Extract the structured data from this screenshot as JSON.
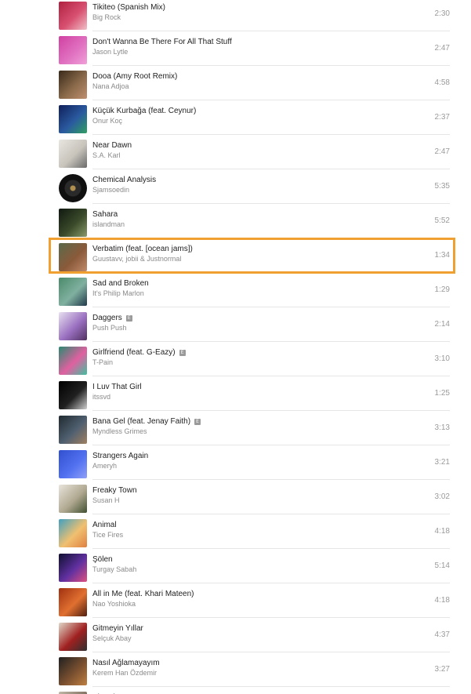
{
  "tracks": [
    {
      "title": "Tikiteo (Spanish Mix)",
      "artist": "Big Rock",
      "duration": "2:30",
      "explicit": false,
      "art": {
        "colors": [
          "#b02040",
          "#d85070",
          "#f0c0c8"
        ],
        "round": false
      }
    },
    {
      "title": "Don't Wanna Be There For All That Stuff",
      "artist": "Jason Lytle",
      "duration": "2:47",
      "explicit": false,
      "art": {
        "colors": [
          "#d040a0",
          "#e070c0",
          "#f0a0d8"
        ],
        "round": false
      }
    },
    {
      "title": "Dooa (Amy Root Remix)",
      "artist": "Nana Adjoa",
      "duration": "4:58",
      "explicit": false,
      "art": {
        "colors": [
          "#3a2a1a",
          "#8a6a4a",
          "#c09070"
        ],
        "round": false
      }
    },
    {
      "title": "Küçük Kurbağa (feat. Ceynur)",
      "artist": "Onur Koç",
      "duration": "2:37",
      "explicit": false,
      "art": {
        "colors": [
          "#10205a",
          "#2a5aa0",
          "#30a060"
        ],
        "round": false
      }
    },
    {
      "title": "Near Dawn",
      "artist": "S.A. Karl",
      "duration": "2:47",
      "explicit": false,
      "art": {
        "colors": [
          "#e8e6e0",
          "#c8c4bc",
          "#6a6a6a"
        ],
        "round": false
      }
    },
    {
      "title": "Chemical Analysis",
      "artist": "Sjamsoedin",
      "duration": "5:35",
      "explicit": false,
      "art": {
        "colors": [
          "#101010",
          "#2a2a2a",
          "#b09050"
        ],
        "round": true
      }
    },
    {
      "title": "Sahara",
      "artist": "islandman",
      "duration": "5:52",
      "explicit": false,
      "art": {
        "colors": [
          "#101810",
          "#3a4a2a",
          "#8a9a6a"
        ],
        "round": false
      }
    },
    {
      "title": "Verbatim (feat. [ocean jams])",
      "artist": "Guustavv, jobii & Justnormal",
      "duration": "1:34",
      "explicit": false,
      "selected": true,
      "art": {
        "colors": [
          "#5a6a4a",
          "#8a5a3a",
          "#c08a6a"
        ],
        "round": false
      }
    },
    {
      "title": "Sad and Broken",
      "artist": "It's Philip Marlon",
      "duration": "1:29",
      "explicit": false,
      "art": {
        "colors": [
          "#4a8a6a",
          "#80b0a0",
          "#203a4a"
        ],
        "round": false
      }
    },
    {
      "title": "Daggers",
      "artist": "Push Push",
      "duration": "2:14",
      "explicit": true,
      "explicit_label": "E",
      "art": {
        "colors": [
          "#e8e0f0",
          "#9a70c0",
          "#503060"
        ],
        "round": false
      }
    },
    {
      "title": "Girlfriend (feat. G-Eazy)",
      "artist": "T-Pain",
      "duration": "3:10",
      "explicit": true,
      "explicit_label": "E",
      "art": {
        "colors": [
          "#2a8a70",
          "#e060a0",
          "#40c0a0"
        ],
        "round": false
      }
    },
    {
      "title": "I Luv That Girl",
      "artist": "itssvd",
      "duration": "1:25",
      "explicit": false,
      "art": {
        "colors": [
          "#000000",
          "#202020",
          "#d0d0d0"
        ],
        "round": false
      }
    },
    {
      "title": "Bana Gel (feat. Jenay Faith)",
      "artist": "Myndless Grimes",
      "duration": "3:13",
      "explicit": true,
      "explicit_label": "E",
      "art": {
        "colors": [
          "#202a30",
          "#506070",
          "#a08060"
        ],
        "round": false
      }
    },
    {
      "title": "Strangers Again",
      "artist": "Ameryh",
      "duration": "3:21",
      "explicit": false,
      "art": {
        "colors": [
          "#3050d0",
          "#5070f0",
          "#90a0f8"
        ],
        "round": false
      }
    },
    {
      "title": "Freaky Town",
      "artist": "Susan H",
      "duration": "3:02",
      "explicit": false,
      "art": {
        "colors": [
          "#e8e4dc",
          "#b0a890",
          "#405030"
        ],
        "round": false
      }
    },
    {
      "title": "Animal",
      "artist": "Tice Fires",
      "duration": "4:18",
      "explicit": false,
      "art": {
        "colors": [
          "#40a0c0",
          "#f0c070",
          "#e08040"
        ],
        "round": false
      }
    },
    {
      "title": "Şölen",
      "artist": "Turgay Sabah",
      "duration": "5:14",
      "explicit": false,
      "art": {
        "colors": [
          "#101030",
          "#6030a0",
          "#e05080"
        ],
        "round": false
      }
    },
    {
      "title": "All in Me (feat. Khari Mateen)",
      "artist": "Nao Yoshioka",
      "duration": "4:18",
      "explicit": false,
      "art": {
        "colors": [
          "#a03010",
          "#e07030",
          "#502010"
        ],
        "round": false
      }
    },
    {
      "title": "Gitmeyin Yıllar",
      "artist": "Selçuk Abay",
      "duration": "4:37",
      "explicit": false,
      "art": {
        "colors": [
          "#e0d8c8",
          "#a02020",
          "#303030"
        ],
        "round": false
      }
    },
    {
      "title": "Nasıl Ağlamayayım",
      "artist": "Kerem Han Özdemir",
      "duration": "3:27",
      "explicit": false,
      "art": {
        "colors": [
          "#202020",
          "#7a5030",
          "#c08040"
        ],
        "round": false
      }
    },
    {
      "title": "Bi' Daha",
      "artist": "",
      "duration": "",
      "explicit": false,
      "art": {
        "colors": [
          "#c0b8a8",
          "#807060",
          "#404040"
        ],
        "round": false
      }
    }
  ]
}
